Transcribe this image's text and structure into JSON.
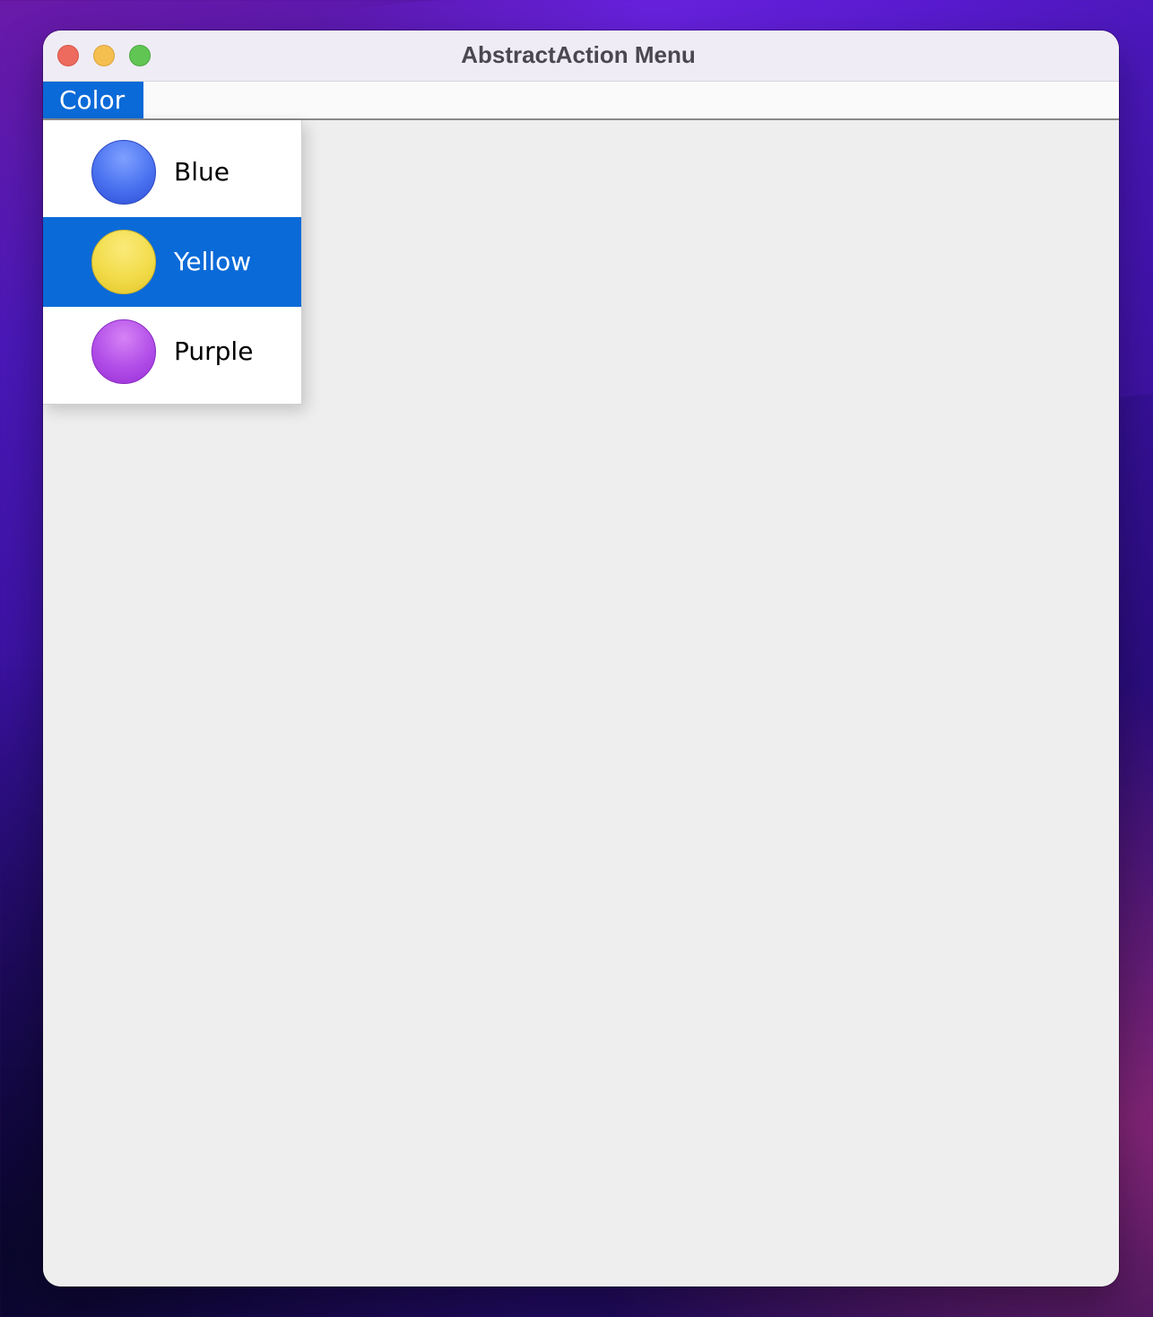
{
  "window": {
    "title": "AbstractAction Menu"
  },
  "menubar": {
    "menus": [
      {
        "label": "Color",
        "open": true
      }
    ]
  },
  "color_menu": {
    "items": [
      {
        "label": "Blue",
        "icon": "blue-circle-icon",
        "color": "#4a72f0",
        "highlighted": false
      },
      {
        "label": "Yellow",
        "icon": "yellow-circle-icon",
        "color": "#f2dc4a",
        "highlighted": true
      },
      {
        "label": "Purple",
        "icon": "purple-circle-icon",
        "color": "#b14ee8",
        "highlighted": false
      }
    ]
  },
  "colors": {
    "selection": "#0a6ad8",
    "content_background": "#eeeeee"
  }
}
